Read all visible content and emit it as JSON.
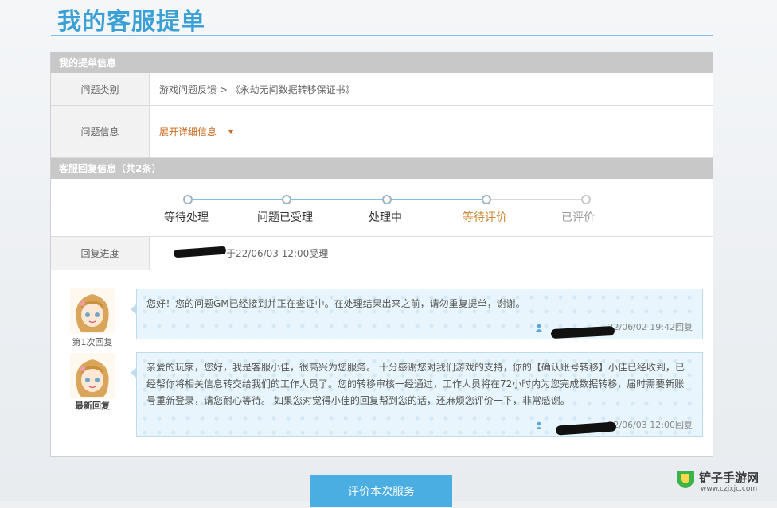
{
  "page": {
    "title": "我的客服提单"
  },
  "ticket_info": {
    "section_title": "我的提单信息",
    "category_label": "问题类别",
    "category_value": "游戏问题反馈 > 《永劫无间数据转移保证书》",
    "info_label": "问题信息",
    "expand_label": "展开详细信息"
  },
  "reply_info": {
    "section_title": "客服回复信息（共2条）",
    "steps": [
      {
        "label": "等待处理",
        "state": "done"
      },
      {
        "label": "问题已受理",
        "state": "done"
      },
      {
        "label": "处理中",
        "state": "done"
      },
      {
        "label": "等待评价",
        "state": "current"
      },
      {
        "label": "已评价",
        "state": "future"
      }
    ],
    "progress_label": "回复进度",
    "progress_value": "于22/06/03 12:00受理"
  },
  "replies": [
    {
      "caption": "第1次回复",
      "text": "您好！您的问题GM已经接到并正在查证中。在处理结果出来之前，请勿重复提单，谢谢。",
      "meta": "22/06/02 19:42回复"
    },
    {
      "caption": "最新回复",
      "text": "亲爱的玩家，您好，我是客服小佳，很高兴为您服务。 十分感谢您对我们游戏的支持，你的【确认账号转移】小佳已经收到，已经帮你将相关信息转交给我们的工作人员了。您的转移审核一经通过，工作人员将在72小时内为您完成数据转移，届时需要新账号重新登录，请您耐心等待。 如果您对觉得小佳的回复帮到您的话，还麻烦您评价一下，非常感谢。",
      "meta": "22/06/03 12:00回复"
    }
  ],
  "footer": {
    "evaluate_button": "评价本次服务"
  },
  "watermark": {
    "name": "铲子手游网",
    "url": "www.czjxjc.com"
  },
  "colors": {
    "accent": "#3aa0d6",
    "section_header": "#c8c8c8",
    "expand_link": "#c86a1e",
    "current_step": "#c8842e",
    "button": "#4aaee2"
  }
}
